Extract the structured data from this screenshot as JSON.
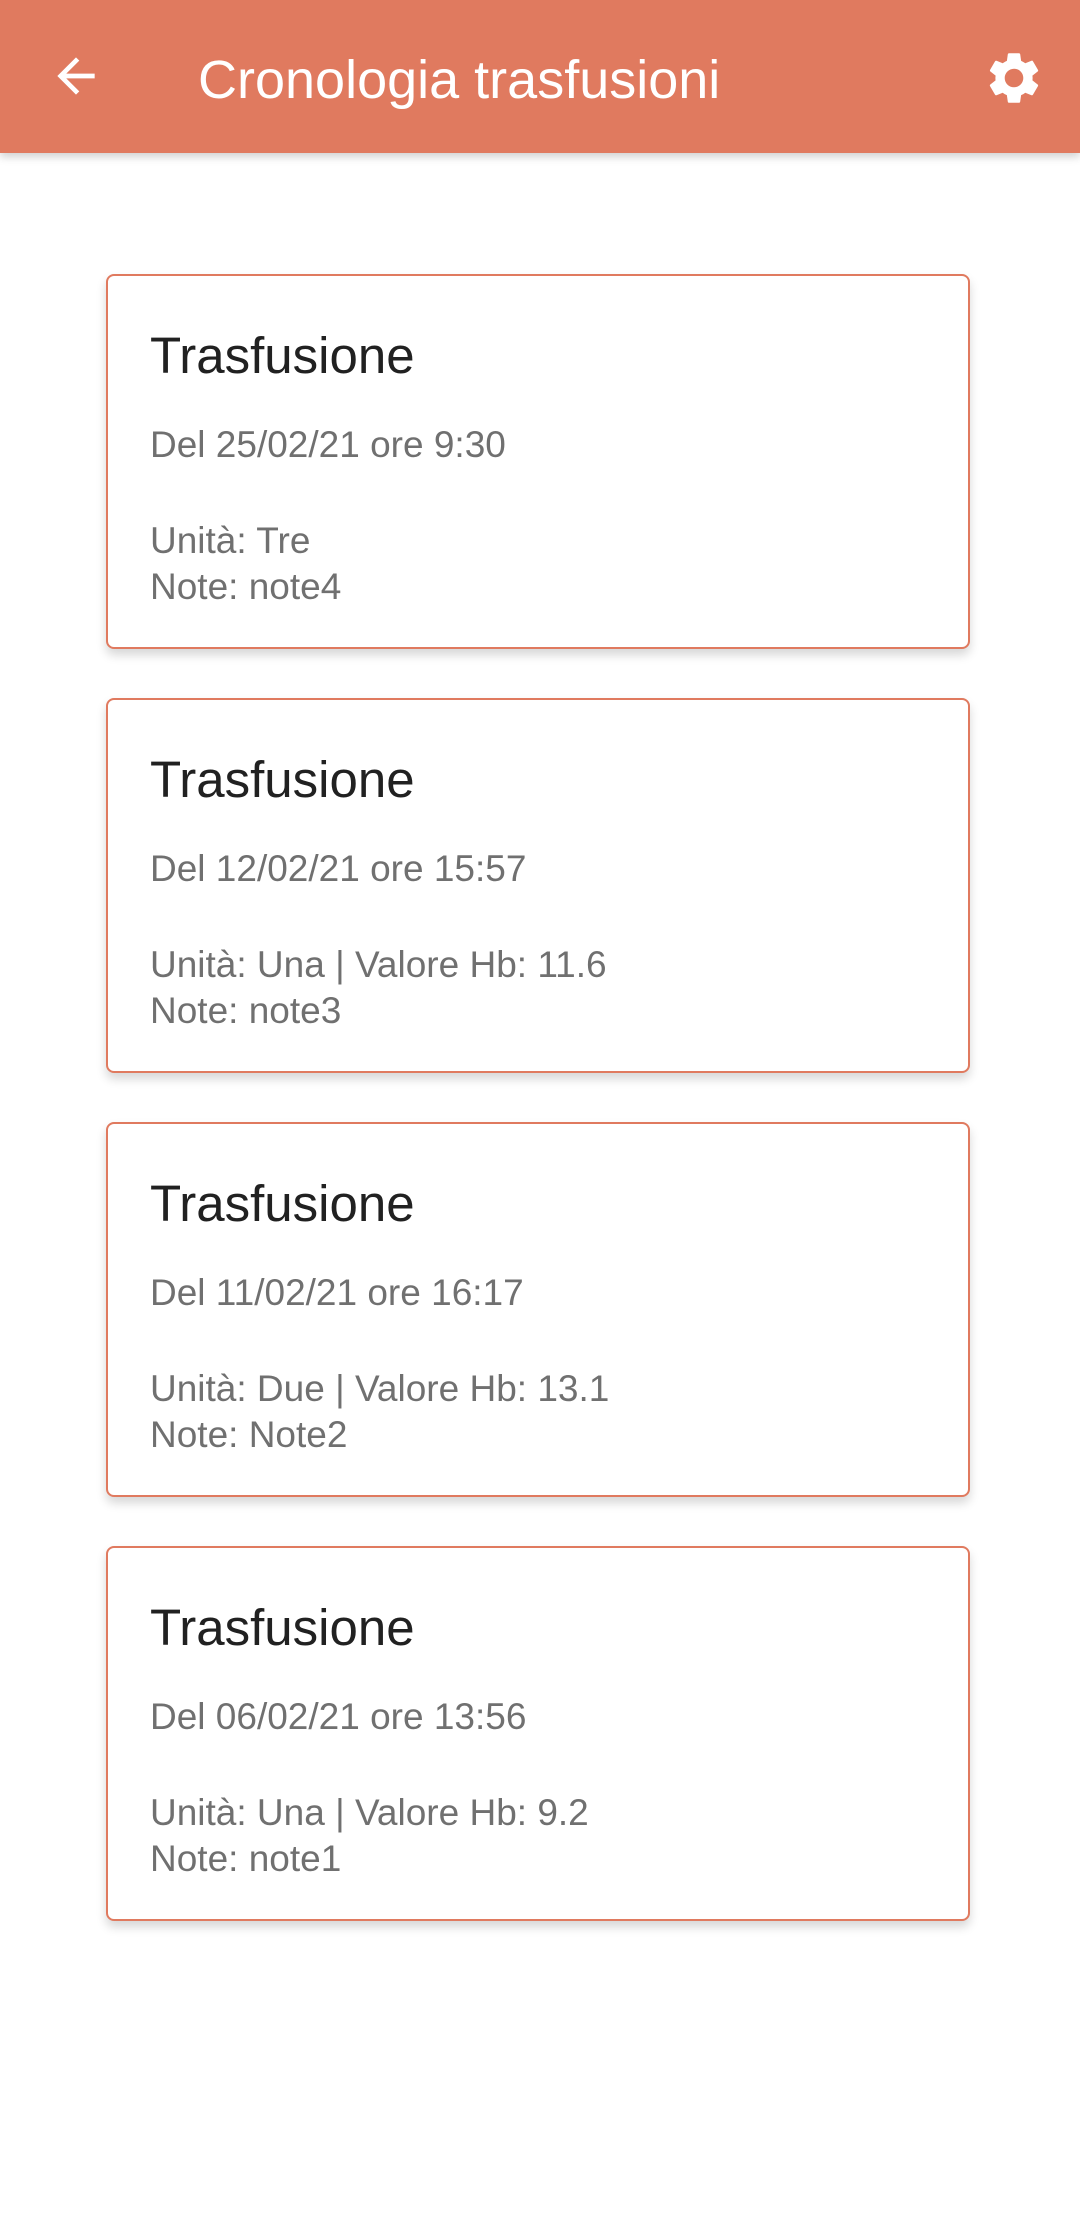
{
  "app_bar": {
    "title": "Cronologia trasfusioni",
    "back_icon": "arrow-back-icon",
    "settings_icon": "gear-icon",
    "background_color": "#e07a5f"
  },
  "transfusions": [
    {
      "title": "Trasfusione",
      "date": "Del 25/02/21 ore 9:30",
      "units": "Unità: Tre",
      "notes": "Note: note4"
    },
    {
      "title": "Trasfusione",
      "date": "Del 12/02/21 ore 15:57",
      "units": "Unità: Una | Valore Hb: 11.6",
      "notes": "Note: note3"
    },
    {
      "title": "Trasfusione",
      "date": "Del 11/02/21 ore 16:17",
      "units": "Unità: Due | Valore Hb: 13.1",
      "notes": "Note: Note2"
    },
    {
      "title": "Trasfusione",
      "date": "Del 06/02/21 ore 13:56",
      "units": "Unità: Una | Valore Hb: 9.2",
      "notes": "Note: note1"
    }
  ],
  "accent_color": "#e07a5f"
}
